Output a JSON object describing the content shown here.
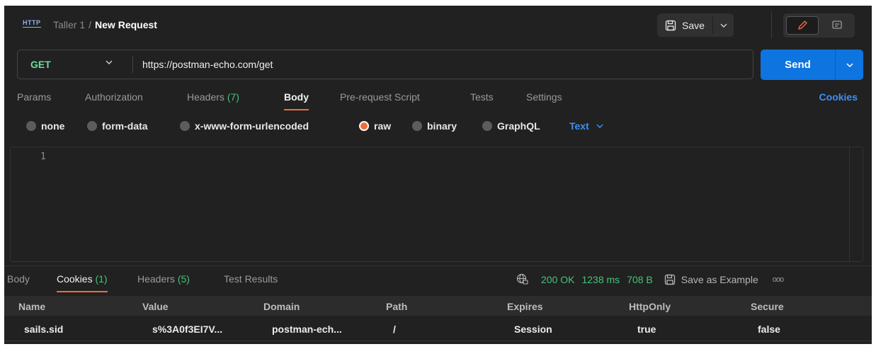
{
  "header": {
    "http_icon_label": "HTTP",
    "breadcrumb_parent": "Taller 1",
    "breadcrumb_separator": "/",
    "breadcrumb_current": "New Request",
    "save_label": "Save"
  },
  "request": {
    "method": "GET",
    "url": "https://postman-echo.com/get",
    "send_label": "Send"
  },
  "request_tabs": [
    {
      "label": "Params",
      "count": ""
    },
    {
      "label": "Authorization",
      "count": ""
    },
    {
      "label": "Headers",
      "count": "(7)"
    },
    {
      "label": "Body",
      "count": "",
      "active": true
    },
    {
      "label": "Pre-request Script",
      "count": ""
    },
    {
      "label": "Tests",
      "count": ""
    },
    {
      "label": "Settings",
      "count": ""
    }
  ],
  "cookies_link": "Cookies",
  "body_types": [
    {
      "label": "none",
      "selected": false
    },
    {
      "label": "form-data",
      "selected": false
    },
    {
      "label": "x-www-form-urlencoded",
      "selected": false
    },
    {
      "label": "raw",
      "selected": true
    },
    {
      "label": "binary",
      "selected": false
    },
    {
      "label": "GraphQL",
      "selected": false
    }
  ],
  "raw_format": "Text",
  "editor": {
    "line_number": "1"
  },
  "response_tabs": [
    {
      "label": "Body",
      "count": ""
    },
    {
      "label": "Cookies",
      "count": "(1)",
      "active": true
    },
    {
      "label": "Headers",
      "count": "(5)"
    },
    {
      "label": "Test Results",
      "count": ""
    }
  ],
  "status": {
    "code": "200 OK",
    "time": "1238 ms",
    "size": "708 B",
    "save_example": "Save as Example",
    "more": "ooo"
  },
  "cookies_table": {
    "columns": [
      "Name",
      "Value",
      "Domain",
      "Path",
      "Expires",
      "HttpOnly",
      "Secure"
    ],
    "rows": [
      [
        "sails.sid",
        "s%3A0f3EI7V...",
        "postman-ech...",
        "/",
        "Session",
        "true",
        "false"
      ]
    ]
  },
  "colors": {
    "accent_orange": "#f26b3a",
    "send_blue": "#0d74e0",
    "method_green": "#6bdd9a",
    "count_green": "#45c476",
    "link_blue": "#3d8ff5"
  }
}
